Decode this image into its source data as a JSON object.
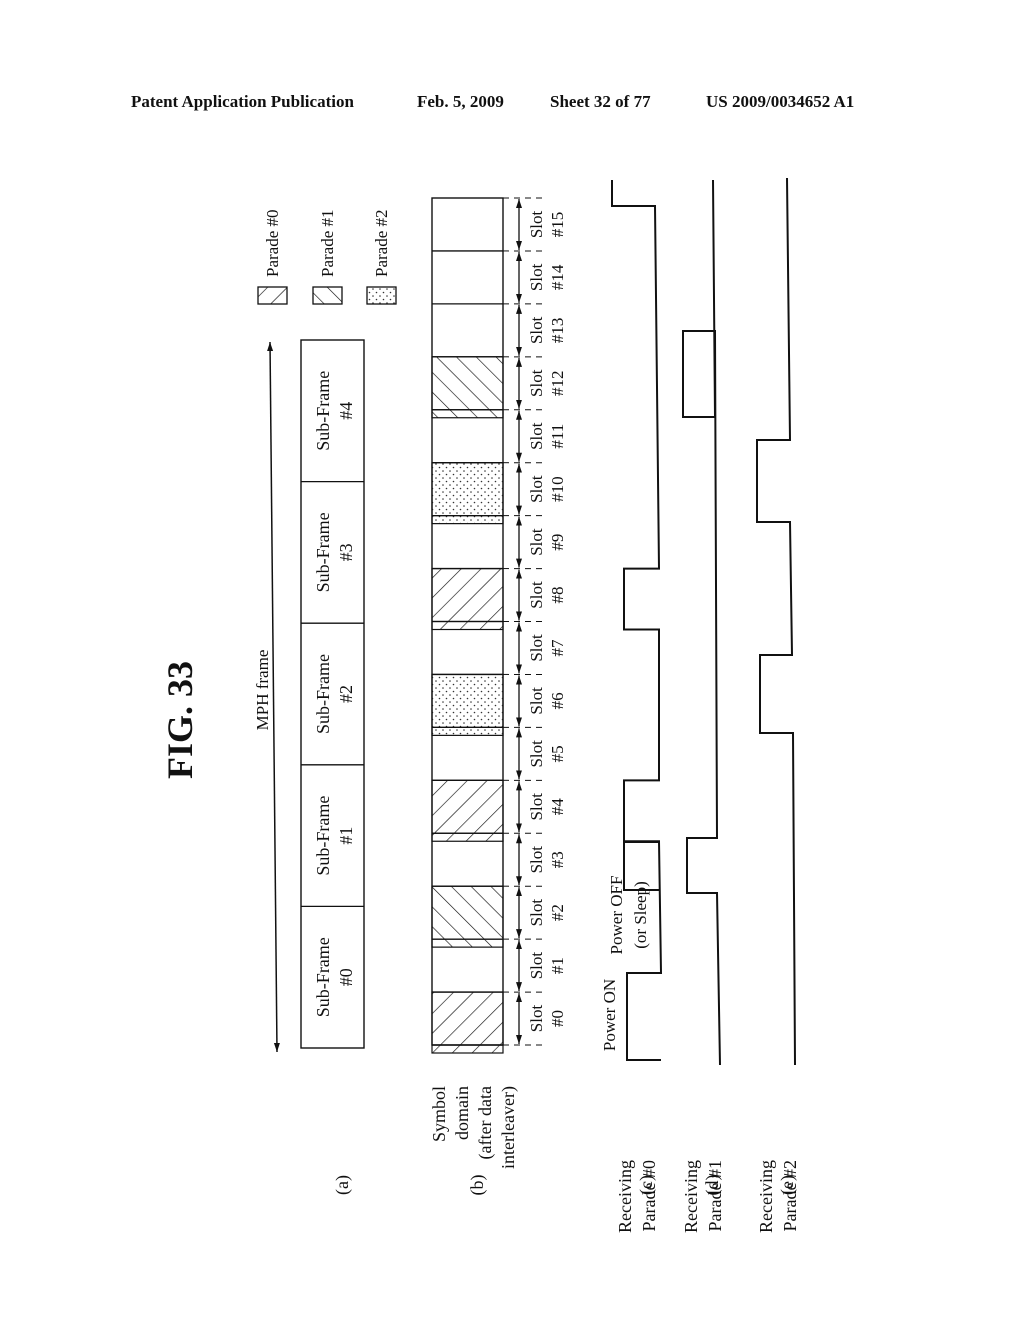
{
  "header": {
    "publication": "Patent Application Publication",
    "date": "Feb. 5, 2009",
    "sheet": "Sheet 32 of 77",
    "patent_number": "US 2009/0034652 A1"
  },
  "figure": {
    "title": "FIG. 33",
    "frame_label": "MPH frame",
    "legend": [
      {
        "pattern": "hatch-back",
        "label": "Parade #0"
      },
      {
        "pattern": "hatch-fwd",
        "label": "Parade #1"
      },
      {
        "pattern": "dots",
        "label": "Parade #2"
      }
    ],
    "rows": {
      "a": {
        "tag": "(a)",
        "lines": []
      },
      "b": {
        "tag": "(b)",
        "lines": [
          "Symbol",
          "domain",
          "(after data",
          "interleaver)"
        ]
      },
      "c": {
        "tag": "(c)",
        "lines": [
          "Receiving",
          "Parade #0"
        ]
      },
      "d": {
        "tag": "(d)",
        "lines": [
          "Receiving",
          "Parade #1"
        ]
      },
      "e": {
        "tag": "(e)",
        "lines": [
          "Receiving",
          "Parade #2"
        ]
      }
    },
    "subframes": [
      {
        "line1": "Sub-Frame",
        "line2": "#0"
      },
      {
        "line1": "Sub-Frame",
        "line2": "#1"
      },
      {
        "line1": "Sub-Frame",
        "line2": "#2"
      },
      {
        "line1": "Sub-Frame",
        "line2": "#3"
      },
      {
        "line1": "Sub-Frame",
        "line2": "#4"
      }
    ],
    "slot_word": "Slot",
    "slots": [
      {
        "label": "#0",
        "parade": 0
      },
      {
        "label": "#1",
        "parade": null
      },
      {
        "label": "#2",
        "parade": 1
      },
      {
        "label": "#3",
        "parade": null
      },
      {
        "label": "#4",
        "parade": 0
      },
      {
        "label": "#5",
        "parade": null
      },
      {
        "label": "#6",
        "parade": 2
      },
      {
        "label": "#7",
        "parade": null
      },
      {
        "label": "#8",
        "parade": 0
      },
      {
        "label": "#9",
        "parade": null
      },
      {
        "label": "#10",
        "parade": 2
      },
      {
        "label": "#11",
        "parade": null
      },
      {
        "label": "#12",
        "parade": 1
      },
      {
        "label": "#13",
        "parade": null
      },
      {
        "label": "#14",
        "parade": null
      },
      {
        "label": "#15",
        "parade": null
      }
    ],
    "power_on_label": "Power ON",
    "power_off_label_1": "Power OFF",
    "power_off_label_2": "(or Sleep)"
  }
}
